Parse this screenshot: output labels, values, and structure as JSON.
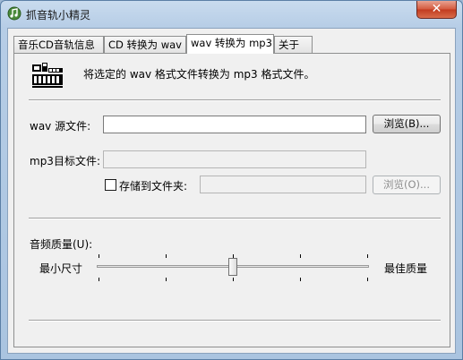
{
  "window": {
    "title": "抓音轨小精灵",
    "close_symbol": "✕",
    "icon": "music-note-app-icon"
  },
  "tabs": [
    {
      "label": "音乐CD音轨信息",
      "active": false
    },
    {
      "label": "CD 转换为 wav",
      "active": false
    },
    {
      "label": "wav 转换为 mp3",
      "active": true
    },
    {
      "label": "关于",
      "active": false
    }
  ],
  "panel": {
    "description": "将选定的 wav 格式文件转换为 mp3 格式文件。",
    "header_icon": "converter-icon",
    "source_label": "wav 源文件:",
    "source_value": "",
    "browse1_label": "浏览(B)...",
    "target_label": "mp3目标文件:",
    "target_value": "",
    "save_to_folder_label": "存储到文件夹:",
    "save_to_folder_checked": false,
    "folder_value": "",
    "browse2_label": "浏览(O)...",
    "quality_label": "音频质量(U):",
    "slider_min_label": "最小尺寸",
    "slider_max_label": "最佳质量",
    "slider_value": 0.5
  },
  "colors": {
    "titlebar": "#c9dbee",
    "close_button": "#d4583d",
    "panel_bg": "#f0f0f0"
  }
}
